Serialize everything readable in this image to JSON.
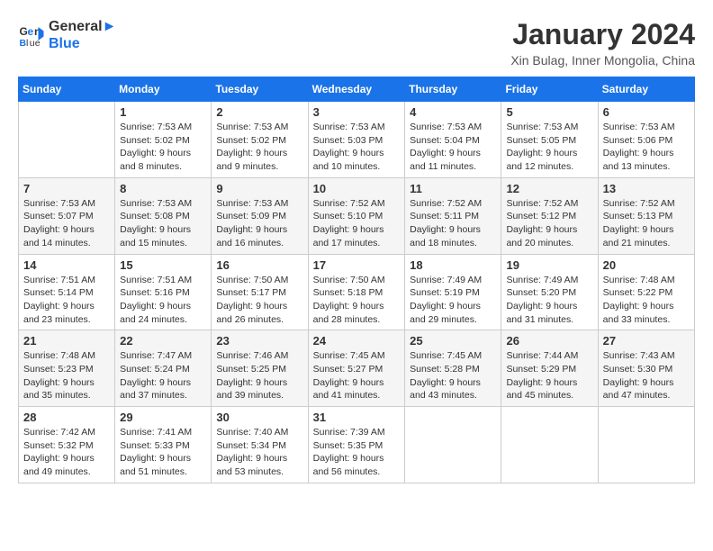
{
  "header": {
    "logo_line1": "General",
    "logo_line2": "Blue",
    "title": "January 2024",
    "subtitle": "Xin Bulag, Inner Mongolia, China"
  },
  "columns": [
    "Sunday",
    "Monday",
    "Tuesday",
    "Wednesday",
    "Thursday",
    "Friday",
    "Saturday"
  ],
  "weeks": [
    [
      {
        "day": "",
        "sunrise": "",
        "sunset": "",
        "daylight": ""
      },
      {
        "day": "1",
        "sunrise": "Sunrise: 7:53 AM",
        "sunset": "Sunset: 5:02 PM",
        "daylight": "Daylight: 9 hours and 8 minutes."
      },
      {
        "day": "2",
        "sunrise": "Sunrise: 7:53 AM",
        "sunset": "Sunset: 5:02 PM",
        "daylight": "Daylight: 9 hours and 9 minutes."
      },
      {
        "day": "3",
        "sunrise": "Sunrise: 7:53 AM",
        "sunset": "Sunset: 5:03 PM",
        "daylight": "Daylight: 9 hours and 10 minutes."
      },
      {
        "day": "4",
        "sunrise": "Sunrise: 7:53 AM",
        "sunset": "Sunset: 5:04 PM",
        "daylight": "Daylight: 9 hours and 11 minutes."
      },
      {
        "day": "5",
        "sunrise": "Sunrise: 7:53 AM",
        "sunset": "Sunset: 5:05 PM",
        "daylight": "Daylight: 9 hours and 12 minutes."
      },
      {
        "day": "6",
        "sunrise": "Sunrise: 7:53 AM",
        "sunset": "Sunset: 5:06 PM",
        "daylight": "Daylight: 9 hours and 13 minutes."
      }
    ],
    [
      {
        "day": "7",
        "sunrise": "Sunrise: 7:53 AM",
        "sunset": "Sunset: 5:07 PM",
        "daylight": "Daylight: 9 hours and 14 minutes."
      },
      {
        "day": "8",
        "sunrise": "Sunrise: 7:53 AM",
        "sunset": "Sunset: 5:08 PM",
        "daylight": "Daylight: 9 hours and 15 minutes."
      },
      {
        "day": "9",
        "sunrise": "Sunrise: 7:53 AM",
        "sunset": "Sunset: 5:09 PM",
        "daylight": "Daylight: 9 hours and 16 minutes."
      },
      {
        "day": "10",
        "sunrise": "Sunrise: 7:52 AM",
        "sunset": "Sunset: 5:10 PM",
        "daylight": "Daylight: 9 hours and 17 minutes."
      },
      {
        "day": "11",
        "sunrise": "Sunrise: 7:52 AM",
        "sunset": "Sunset: 5:11 PM",
        "daylight": "Daylight: 9 hours and 18 minutes."
      },
      {
        "day": "12",
        "sunrise": "Sunrise: 7:52 AM",
        "sunset": "Sunset: 5:12 PM",
        "daylight": "Daylight: 9 hours and 20 minutes."
      },
      {
        "day": "13",
        "sunrise": "Sunrise: 7:52 AM",
        "sunset": "Sunset: 5:13 PM",
        "daylight": "Daylight: 9 hours and 21 minutes."
      }
    ],
    [
      {
        "day": "14",
        "sunrise": "Sunrise: 7:51 AM",
        "sunset": "Sunset: 5:14 PM",
        "daylight": "Daylight: 9 hours and 23 minutes."
      },
      {
        "day": "15",
        "sunrise": "Sunrise: 7:51 AM",
        "sunset": "Sunset: 5:16 PM",
        "daylight": "Daylight: 9 hours and 24 minutes."
      },
      {
        "day": "16",
        "sunrise": "Sunrise: 7:50 AM",
        "sunset": "Sunset: 5:17 PM",
        "daylight": "Daylight: 9 hours and 26 minutes."
      },
      {
        "day": "17",
        "sunrise": "Sunrise: 7:50 AM",
        "sunset": "Sunset: 5:18 PM",
        "daylight": "Daylight: 9 hours and 28 minutes."
      },
      {
        "day": "18",
        "sunrise": "Sunrise: 7:49 AM",
        "sunset": "Sunset: 5:19 PM",
        "daylight": "Daylight: 9 hours and 29 minutes."
      },
      {
        "day": "19",
        "sunrise": "Sunrise: 7:49 AM",
        "sunset": "Sunset: 5:20 PM",
        "daylight": "Daylight: 9 hours and 31 minutes."
      },
      {
        "day": "20",
        "sunrise": "Sunrise: 7:48 AM",
        "sunset": "Sunset: 5:22 PM",
        "daylight": "Daylight: 9 hours and 33 minutes."
      }
    ],
    [
      {
        "day": "21",
        "sunrise": "Sunrise: 7:48 AM",
        "sunset": "Sunset: 5:23 PM",
        "daylight": "Daylight: 9 hours and 35 minutes."
      },
      {
        "day": "22",
        "sunrise": "Sunrise: 7:47 AM",
        "sunset": "Sunset: 5:24 PM",
        "daylight": "Daylight: 9 hours and 37 minutes."
      },
      {
        "day": "23",
        "sunrise": "Sunrise: 7:46 AM",
        "sunset": "Sunset: 5:25 PM",
        "daylight": "Daylight: 9 hours and 39 minutes."
      },
      {
        "day": "24",
        "sunrise": "Sunrise: 7:45 AM",
        "sunset": "Sunset: 5:27 PM",
        "daylight": "Daylight: 9 hours and 41 minutes."
      },
      {
        "day": "25",
        "sunrise": "Sunrise: 7:45 AM",
        "sunset": "Sunset: 5:28 PM",
        "daylight": "Daylight: 9 hours and 43 minutes."
      },
      {
        "day": "26",
        "sunrise": "Sunrise: 7:44 AM",
        "sunset": "Sunset: 5:29 PM",
        "daylight": "Daylight: 9 hours and 45 minutes."
      },
      {
        "day": "27",
        "sunrise": "Sunrise: 7:43 AM",
        "sunset": "Sunset: 5:30 PM",
        "daylight": "Daylight: 9 hours and 47 minutes."
      }
    ],
    [
      {
        "day": "28",
        "sunrise": "Sunrise: 7:42 AM",
        "sunset": "Sunset: 5:32 PM",
        "daylight": "Daylight: 9 hours and 49 minutes."
      },
      {
        "day": "29",
        "sunrise": "Sunrise: 7:41 AM",
        "sunset": "Sunset: 5:33 PM",
        "daylight": "Daylight: 9 hours and 51 minutes."
      },
      {
        "day": "30",
        "sunrise": "Sunrise: 7:40 AM",
        "sunset": "Sunset: 5:34 PM",
        "daylight": "Daylight: 9 hours and 53 minutes."
      },
      {
        "day": "31",
        "sunrise": "Sunrise: 7:39 AM",
        "sunset": "Sunset: 5:35 PM",
        "daylight": "Daylight: 9 hours and 56 minutes."
      },
      {
        "day": "",
        "sunrise": "",
        "sunset": "",
        "daylight": ""
      },
      {
        "day": "",
        "sunrise": "",
        "sunset": "",
        "daylight": ""
      },
      {
        "day": "",
        "sunrise": "",
        "sunset": "",
        "daylight": ""
      }
    ]
  ]
}
